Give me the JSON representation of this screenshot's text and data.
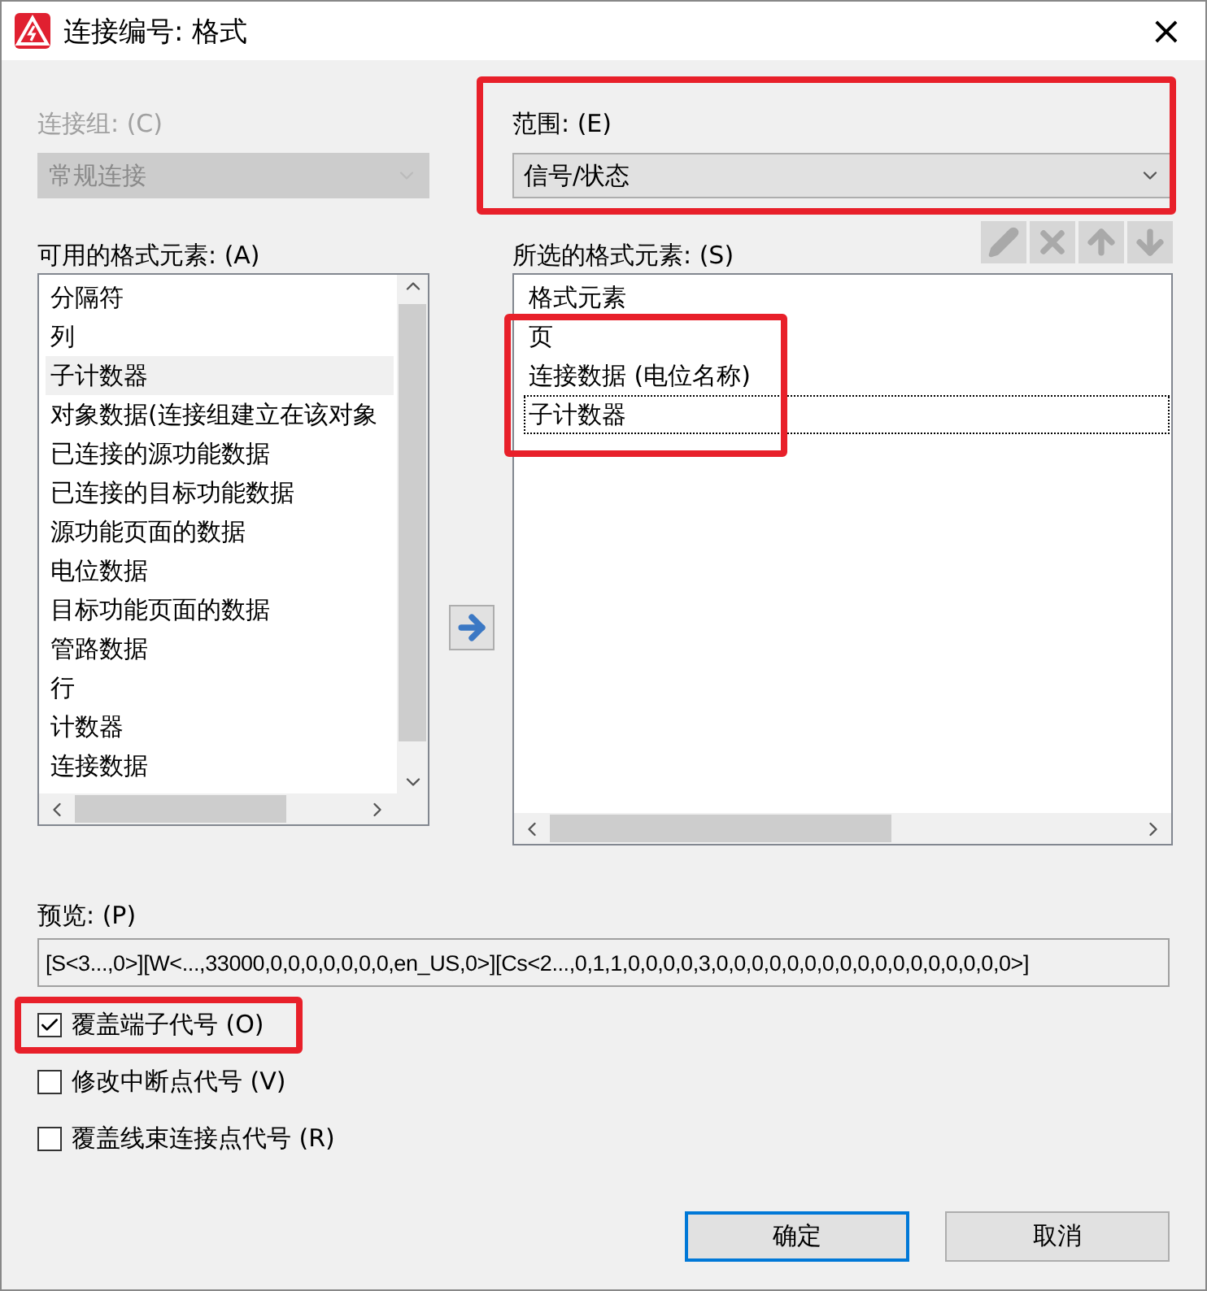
{
  "window": {
    "title": "连接编号: 格式",
    "close": "×"
  },
  "connection_group": {
    "label": "连接组: (C)",
    "value": "常规连接",
    "disabled": true
  },
  "scope": {
    "label": "范围: (E)",
    "value": "信号/状态",
    "disabled": false,
    "highlighted": true
  },
  "available": {
    "label": "可用的格式元素: (A)",
    "items": [
      {
        "text": "分隔符",
        "selected": false
      },
      {
        "text": "列",
        "selected": false
      },
      {
        "text": "子计数器",
        "selected": true
      },
      {
        "text": "对象数据(连接组建立在该对象",
        "selected": false
      },
      {
        "text": "已连接的源功能数据",
        "selected": false
      },
      {
        "text": "已连接的目标功能数据",
        "selected": false
      },
      {
        "text": "源功能页面的数据",
        "selected": false
      },
      {
        "text": "电位数据",
        "selected": false
      },
      {
        "text": "目标功能页面的数据",
        "selected": false
      },
      {
        "text": "管路数据",
        "selected": false
      },
      {
        "text": "行",
        "selected": false
      },
      {
        "text": "计数器",
        "selected": false
      },
      {
        "text": "连接数据",
        "selected": false
      }
    ]
  },
  "chosen": {
    "label": "所选的格式元素: (S)",
    "highlighted": true,
    "tools": [
      {
        "kind": "edit",
        "disabled": true
      },
      {
        "kind": "delete",
        "disabled": true
      },
      {
        "kind": "up",
        "disabled": true
      },
      {
        "kind": "down",
        "disabled": true
      }
    ],
    "header": "格式元素",
    "items": [
      {
        "text": "页",
        "focused": false
      },
      {
        "text": "连接数据 (电位名称)",
        "focused": false
      },
      {
        "text": "子计数器",
        "focused": true
      }
    ]
  },
  "preview": {
    "label": "预览: (P)",
    "value": "[S<3...,0>][W<...,33000,0,0,0,0,0,0,0,en_US,0>][Cs<2...,0,1,1,0,0,0,0,3,0,0,0,0,0,0,0,0,0,0,0,0,0,0,0,0,0>]"
  },
  "options": [
    {
      "label": "覆盖端子代号 (O)",
      "checked": true,
      "highlighted": true
    },
    {
      "label": "修改中断点代号 (V)",
      "checked": false,
      "highlighted": false
    },
    {
      "label": "覆盖线束连接点代号 (R)",
      "checked": false,
      "highlighted": false
    }
  ],
  "buttons": [
    {
      "label": "确定",
      "default": true
    },
    {
      "label": "取消",
      "default": false
    }
  ]
}
